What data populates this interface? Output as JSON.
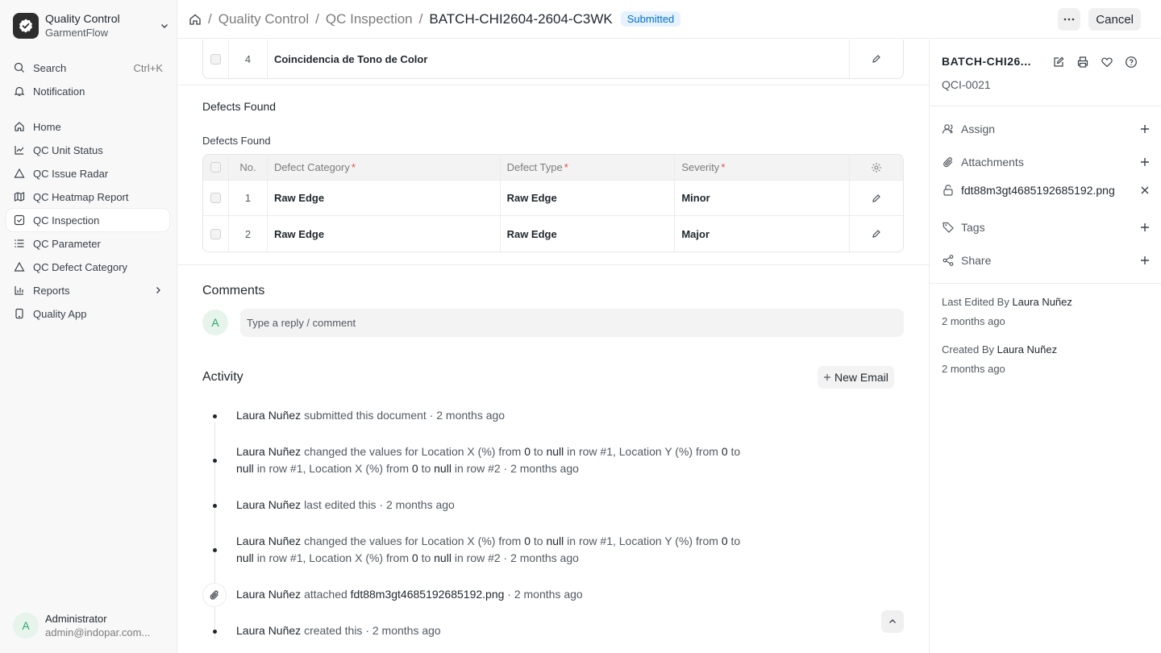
{
  "app": {
    "title": "Quality Control",
    "subtitle": "GarmentFlow"
  },
  "sidebar": {
    "search": {
      "label": "Search",
      "shortcut": "Ctrl+K"
    },
    "notification": {
      "label": "Notification"
    },
    "items": [
      {
        "label": "Home"
      },
      {
        "label": "QC Unit Status"
      },
      {
        "label": "QC Issue Radar"
      },
      {
        "label": "QC Heatmap Report"
      },
      {
        "label": "QC Inspection"
      },
      {
        "label": "QC Parameter"
      },
      {
        "label": "QC Defect Category"
      },
      {
        "label": "Reports"
      },
      {
        "label": "Quality App"
      }
    ],
    "user": {
      "initial": "A",
      "name": "Administrator",
      "email": "admin@indopar.com..."
    }
  },
  "breadcrumb": {
    "items": [
      "Quality Control",
      "QC Inspection",
      "BATCH-CHI2604-2604-C3WK"
    ],
    "status": "Submitted"
  },
  "topbar": {
    "cancel_label": "Cancel"
  },
  "params_table": {
    "rows": [
      {
        "no": "4",
        "name": "Coincidencia de Tono de Color"
      }
    ]
  },
  "defects": {
    "section_title": "Defects Found",
    "table_label": "Defects Found",
    "headers": {
      "no": "No.",
      "category": "Defect Category",
      "type": "Defect Type",
      "severity": "Severity"
    },
    "rows": [
      {
        "no": "1",
        "category": "Raw Edge",
        "type": "Raw Edge",
        "severity": "Minor"
      },
      {
        "no": "2",
        "category": "Raw Edge",
        "type": "Raw Edge",
        "severity": "Major"
      }
    ]
  },
  "comments": {
    "title": "Comments",
    "avatar": "A",
    "placeholder": "Type a reply / comment"
  },
  "activity": {
    "title": "Activity",
    "new_email": "New Email",
    "entries": [
      {
        "who": "Laura Nuñez",
        "text": "submitted this document",
        "time": "· 2 months ago"
      },
      {
        "who": "Laura Nuñez",
        "l1a": "changed the values for Location X (%) from",
        "v1": "0",
        "to1": "to",
        "v2": "null",
        "l1b": "in row #1, Location Y (%) from",
        "v3": "0",
        "to2": "to",
        "v4": "null",
        "l2a": "in row #1, Location X (%) from",
        "v5": "0",
        "to3": "to",
        "v6": "null",
        "l2b": "in row #2",
        "time": "· 2 months ago"
      },
      {
        "who": "Laura Nuñez",
        "text": "last edited this",
        "time": "· 2 months ago"
      },
      {
        "who": "Laura Nuñez",
        "l1a": "changed the values for Location X (%) from",
        "v1": "0",
        "to1": "to",
        "v2": "null",
        "l1b": "in row #1, Location Y (%) from",
        "v3": "0",
        "to2": "to",
        "v4": "null",
        "l2a": "in row #1, Location X (%) from",
        "v5": "0",
        "to3": "to",
        "v6": "null",
        "l2b": "in row #2",
        "time": "· 2 months ago"
      },
      {
        "who": "Laura Nuñez",
        "text": "attached",
        "file": "fdt88m3gt4685192685192.png",
        "time": "· 2 months ago"
      },
      {
        "who": "Laura Nuñez",
        "text": "created this",
        "time": "· 2 months ago"
      }
    ]
  },
  "rpanel": {
    "title": "BATCH-CHI26...",
    "code": "QCI-0021",
    "assign": "Assign",
    "attachments": "Attachments",
    "file": "fdt88m3gt4685192685192.png",
    "tags": "Tags",
    "share": "Share",
    "last_edited_by_label": "Last Edited By",
    "last_edited_by": "Laura Nuñez",
    "last_edited_time": "2 months ago",
    "created_by_label": "Created By",
    "created_by": "Laura Nuñez",
    "created_time": "2 months ago"
  },
  "colors": {
    "status_badge_bg": "#e6f2ff",
    "status_badge_text": "#0070cc",
    "required": "#e24c4c",
    "avatar_bg": "#e6f4ec",
    "avatar_text": "#30a66d"
  }
}
